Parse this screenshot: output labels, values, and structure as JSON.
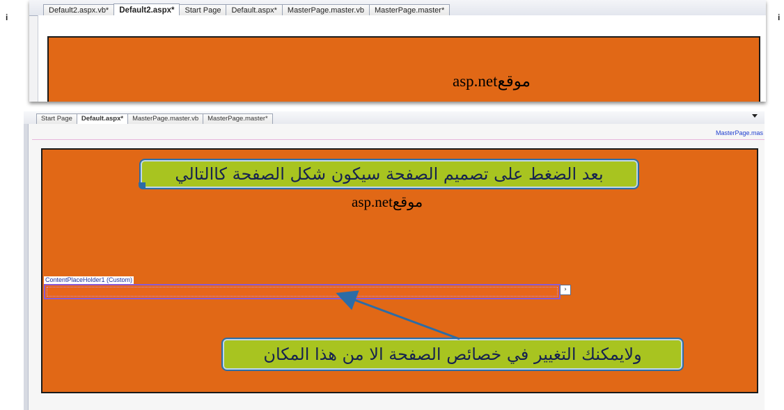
{
  "top_screenshot": {
    "tabs": [
      "Default2.aspx.vb*",
      "Default2.aspx*",
      "Start Page",
      "Default.aspx*",
      "MasterPage.master.vb",
      "MasterPage.master*"
    ],
    "active_tab": "Default2.aspx*",
    "site_text": "موقعasp.net"
  },
  "stray_marks": {
    "left": "i",
    "right": "i"
  },
  "bottom_screenshot": {
    "tabs": [
      "Start Page",
      "Default.aspx*",
      "MasterPage.master.vb",
      "MasterPage.master*"
    ],
    "active_tab": "Default.aspx*",
    "master_link": "MasterPage.mas",
    "site_text": "موقعasp.net",
    "content_placeholder_label": "ContentPlaceHolder1 (Custom)",
    "content_placeholder_button": "›",
    "callout_top": "بعد الضغط على تصميم الصفحة  سيكون شكل الصفحة كاالتالي",
    "callout_bottom": "ولايمكنك التغيير في خصائص الصفحة الا من هذا المكان"
  },
  "colors": {
    "page_orange": "#e16816",
    "callout_green": "#a8c420",
    "callout_border": "#2c6ca6",
    "link_blue": "#1f3fcf",
    "placeholder_border": "#8a5bd6"
  },
  "icons": [
    "dropdown-arrow-icon",
    "smart-tag-arrow-icon"
  ]
}
